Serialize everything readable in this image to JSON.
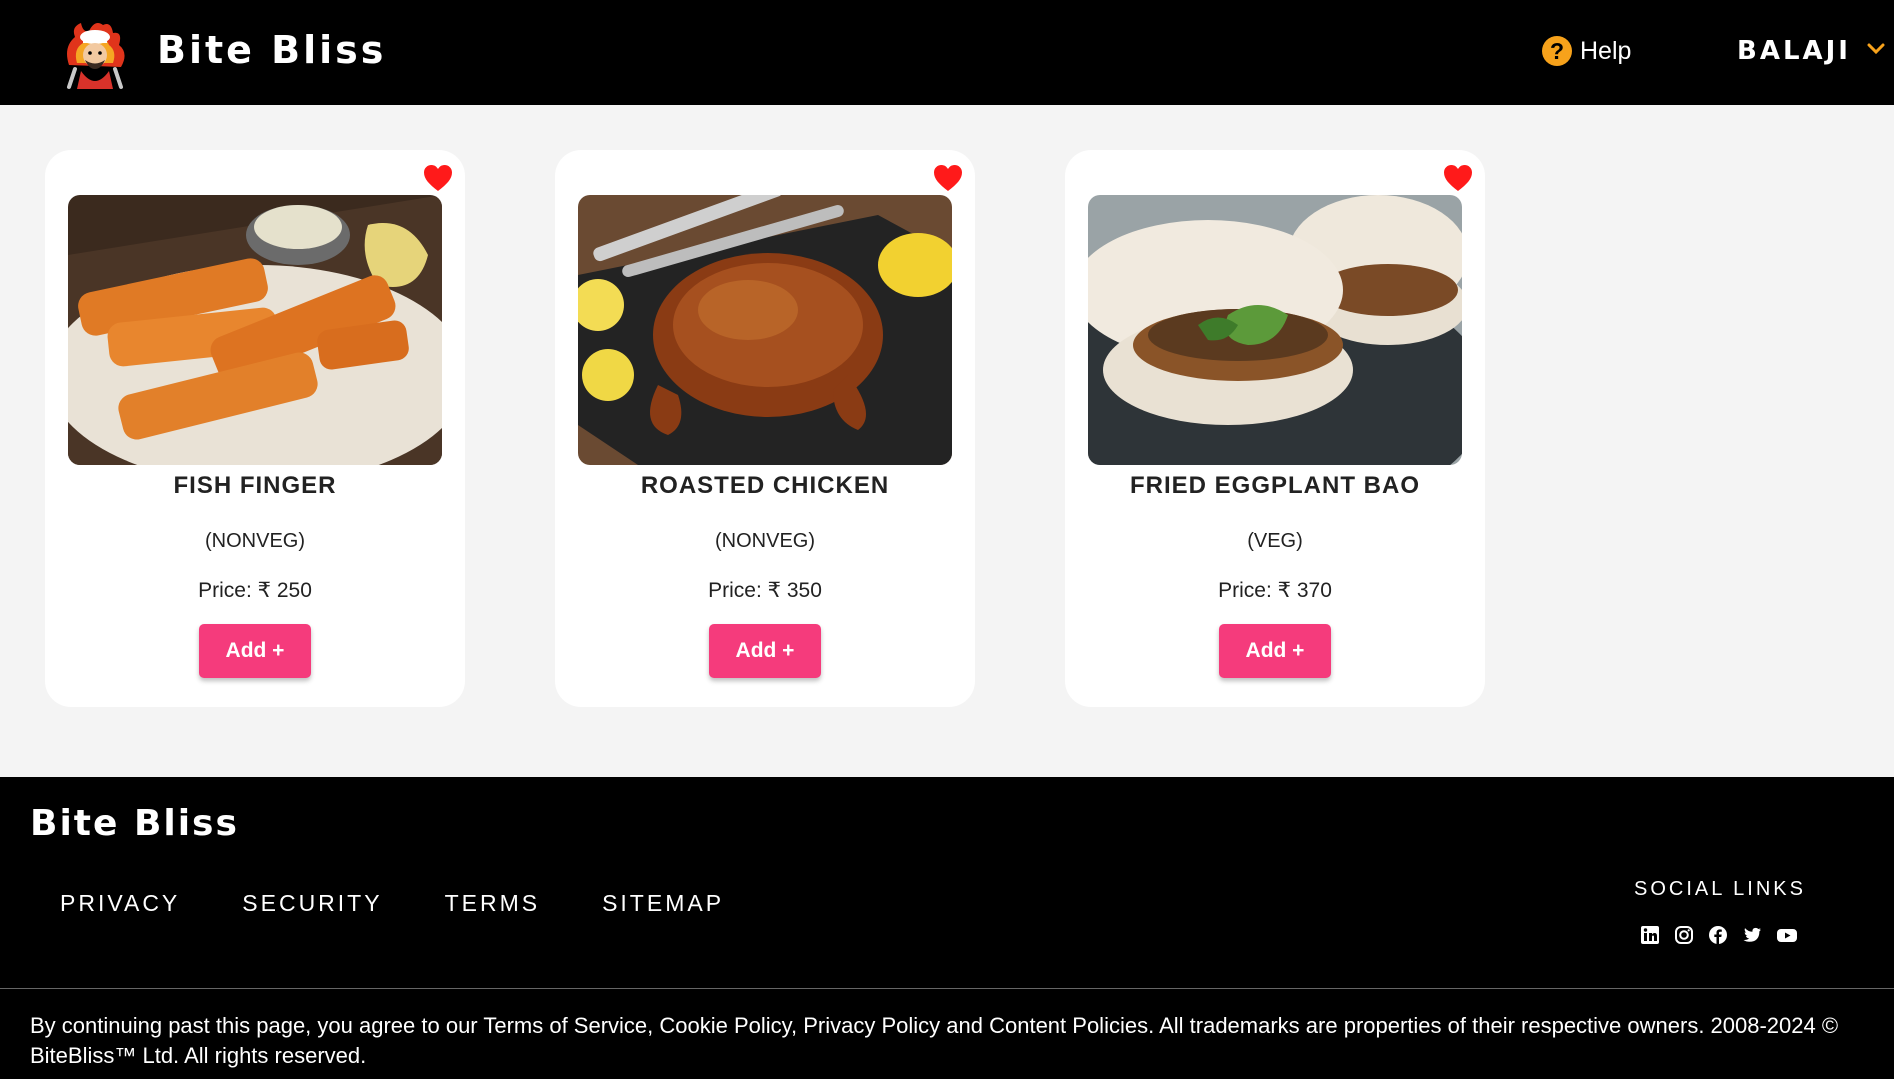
{
  "header": {
    "brand": "Bite Bliss",
    "help_label": "Help",
    "user_name": "BALAJI"
  },
  "products": [
    {
      "name": "FISH FINGER",
      "type": "(NONVEG)",
      "price": "Price: ₹ 250",
      "add_label": "Add +"
    },
    {
      "name": "ROASTED CHICKEN",
      "type": "(NONVEG)",
      "price": "Price: ₹ 350",
      "add_label": "Add +"
    },
    {
      "name": "FRIED EGGPLANT BAO",
      "type": "(VEG)",
      "price": "Price: ₹ 370",
      "add_label": "Add +"
    }
  ],
  "footer": {
    "brand": "Bite Bliss",
    "links": [
      "PRIVACY",
      "SECURITY",
      "TERMS",
      "SITEMAP"
    ],
    "social_title": "SOCIAL LINKS",
    "social_icons": [
      "linkedin-icon",
      "instagram-icon",
      "facebook-icon",
      "twitter-icon",
      "youtube-icon"
    ],
    "legal": "By continuing past this page, you agree to our Terms of Service, Cookie Policy, Privacy Policy and Content Policies. All trademarks are properties of their respective owners. 2008-2024 © BiteBliss™ Ltd. All rights reserved."
  },
  "colors": {
    "header_bg": "#000000",
    "accent_button": "#f53b7c",
    "help_icon": "#f7a21b",
    "heart": "#ff1a1a"
  }
}
